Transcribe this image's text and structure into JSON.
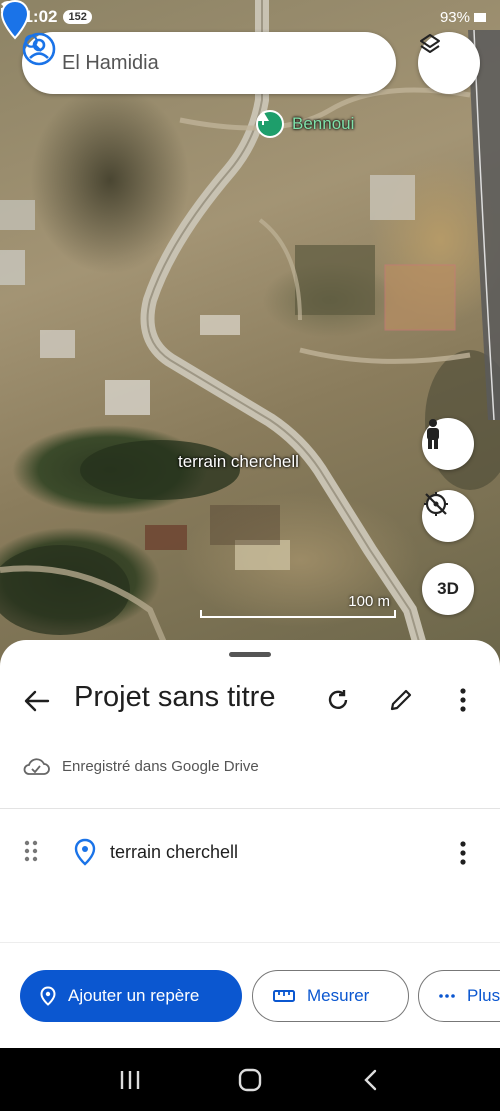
{
  "status_bar": {
    "time": "21:02",
    "notification_count": "152",
    "battery": "93%"
  },
  "search": {
    "value": "El Hamidia"
  },
  "map": {
    "place_label": "Bennoui",
    "marker_label": "terrain cherchell",
    "scale_label": "100 m",
    "button_3d": "3D"
  },
  "sheet": {
    "title": "Projet sans titre",
    "saved_status": "Enregistré dans Google Drive",
    "items": [
      {
        "label": "terrain cherchell"
      }
    ],
    "chips": {
      "add_marker": "Ajouter un repère",
      "measure": "Mesurer",
      "more": "Plus"
    }
  },
  "colors": {
    "accent": "#0b57d0",
    "place_pin": "#1e9e6b",
    "marker_pin": "#1a73e8"
  },
  "icons": [
    "search-icon",
    "account-icon",
    "layers-icon",
    "pegman-icon",
    "compass-icon",
    "back-arrow-icon",
    "refresh-icon",
    "edit-icon",
    "more-vert-icon",
    "cloud-done-icon",
    "drag-handle-icon",
    "location-pin-icon",
    "ruler-icon",
    "more-horiz-icon"
  ]
}
